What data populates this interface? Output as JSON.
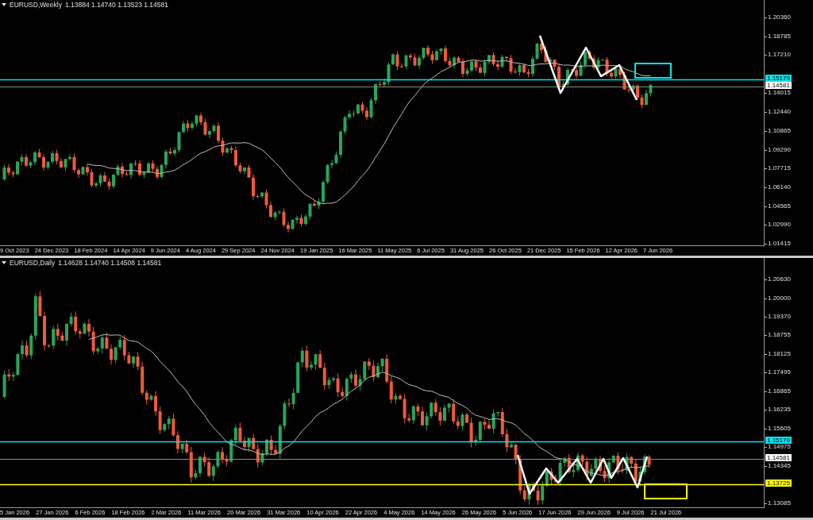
{
  "charts": [
    {
      "symbol": "EURUSD,Weekly",
      "ohlc": "1.13884 1.14740 1.13523 1.14581",
      "price_ticks": [
        "1.20360",
        "1.18785",
        "1.17210",
        "1.14015",
        "1.12440",
        "1.10865",
        "1.09290",
        "1.07715",
        "1.06140",
        "1.04565",
        "1.02990",
        "1.01415"
      ],
      "price_levels": [
        {
          "label": "1.15179",
          "kind": "level",
          "color": "#00e5ee"
        },
        {
          "label": "1.14581",
          "kind": "bid",
          "color": "#ffffff"
        }
      ],
      "dates": [
        "9 Oct 2023",
        "24 Dec 2023",
        "18 Feb 2024",
        "14 Apr 2024",
        "9 Jun 2024",
        "4 Aug 2024",
        "29 Sep 2024",
        "24 Nov 2024",
        "19 Jan 2025",
        "16 Mar 2025",
        "11 May 2025",
        "6 Jul 2025",
        "31 Aug 2025",
        "26 Oct 2025",
        "21 Dec 2025",
        "15 Feb 2026",
        "12 Apr 2026",
        "7 Jun 2026"
      ]
    },
    {
      "symbol": "EURUSD,Daily",
      "ohlc": "1.14628 1.14740 1.14508 1.14581",
      "price_ticks": [
        "1.20630",
        "1.20000",
        "1.19370",
        "1.18755",
        "1.18125",
        "1.17495",
        "1.16865",
        "1.16235",
        "1.15605",
        "1.14975",
        "1.14345",
        "1.13085"
      ],
      "price_levels": [
        {
          "label": "1.15179",
          "kind": "level",
          "color": "#00e5ee"
        },
        {
          "label": "1.14581",
          "kind": "bid",
          "color": "#ffffff"
        },
        {
          "label": "1.13725",
          "kind": "level",
          "color": "#ffff00"
        }
      ],
      "dates": [
        "5 Jan 2026",
        "27 Jan 2026",
        "6 Feb 2026",
        "18 Feb 2026",
        "2 Mar 2026",
        "11 Mar 2026",
        "20 Mar 2026",
        "31 Mar 2026",
        "10 Apr 2026",
        "22 Apr 2026",
        "4 May 2026",
        "14 May 2026",
        "26 May 2026",
        "5 Jun 2026",
        "17 Jun 2026",
        "29 Jun 2026",
        "9 Jul 2026",
        "21 Jul 2026"
      ]
    }
  ]
}
